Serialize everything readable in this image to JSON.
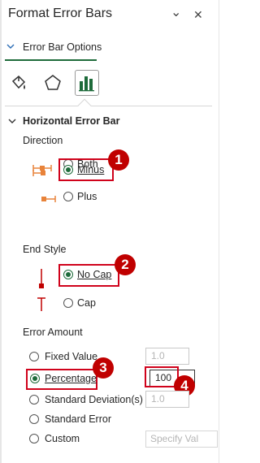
{
  "pane": {
    "title": "Format Error Bars",
    "close_glyph": "✕",
    "dropdown_glyph": "⌄"
  },
  "options_header": {
    "label": "Error Bar Options"
  },
  "icon_tabs": [
    {
      "name": "fill-line-icon",
      "active": false
    },
    {
      "name": "effects-pentagon-icon",
      "active": false
    },
    {
      "name": "error-bar-options-icon",
      "active": true
    }
  ],
  "section": {
    "title": "Horizontal Error Bar"
  },
  "direction": {
    "label": "Direction",
    "options": [
      {
        "label": "Both",
        "selected": false
      },
      {
        "label": "Minus",
        "selected": true
      },
      {
        "label": "Plus",
        "selected": false
      }
    ]
  },
  "end_style": {
    "label": "End Style",
    "options": [
      {
        "label": "No Cap",
        "selected": true
      },
      {
        "label": "Cap",
        "selected": false
      }
    ]
  },
  "error_amount": {
    "label": "Error Amount",
    "options": [
      {
        "label": "Fixed Value",
        "selected": false,
        "value": "1.0"
      },
      {
        "label": "Percentage",
        "selected": true,
        "value": "100"
      },
      {
        "label": "Standard Deviation(s)",
        "selected": false,
        "value": "1.0"
      },
      {
        "label": "Standard Error",
        "selected": false
      },
      {
        "label": "Custom",
        "selected": false
      }
    ],
    "specify_value_button": "Specify Val"
  },
  "callouts": [
    "1",
    "2",
    "3",
    "4"
  ],
  "colors": {
    "accent": "#1e6b3a",
    "callout": "#c00000",
    "highlight_border": "#d0021b",
    "marker_orange": "#e8833a",
    "marker_red": "#c00000"
  }
}
